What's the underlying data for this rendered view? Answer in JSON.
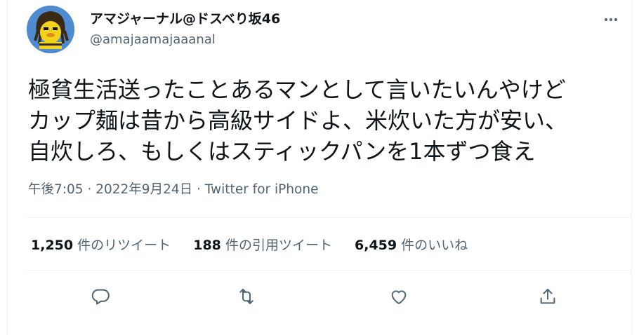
{
  "user": {
    "name": "アマジャーナル@ドスベり坂46",
    "handle": "@amajaamajaaanal"
  },
  "more_icon": "more-dots-icon",
  "tweet": {
    "lines": [
      "極貧生活送ったことあるマンとして言いたいんやけど",
      "カップ麺は昔から高級サイドよ、米炊いた方が安い、",
      "自炊しろ、もしくはスティックパンを1本ずつ食え"
    ]
  },
  "meta": {
    "time": "午後7:05",
    "separator": "·",
    "date": "2022年9月24日",
    "source": "Twitter for iPhone"
  },
  "stats": {
    "retweets": {
      "count": "1,250",
      "label": "件のリツイート"
    },
    "quotes": {
      "count": "188",
      "label": "件の引用ツイート"
    },
    "likes": {
      "count": "6,459",
      "label": "件のいいね"
    }
  },
  "actions": [
    "reply-icon",
    "retweet-icon",
    "like-icon",
    "share-icon"
  ],
  "colors": {
    "text": "#0f1419",
    "secondary": "#536471",
    "border": "#eff3f4"
  }
}
